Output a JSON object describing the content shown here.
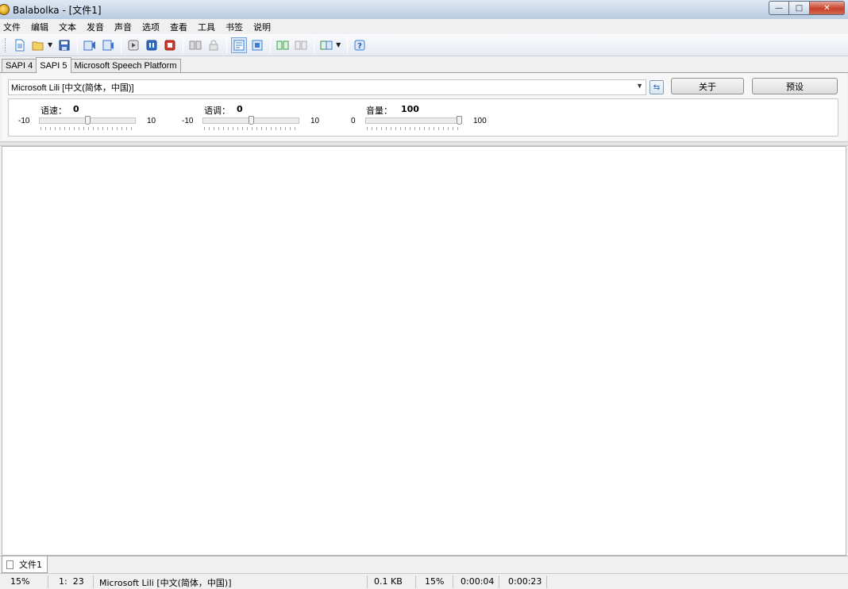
{
  "window": {
    "title": "Balabolka - [文件1]"
  },
  "menu": [
    "文件",
    "编辑",
    "文本",
    "发音",
    "声音",
    "选项",
    "查看",
    "工具",
    "书签",
    "说明"
  ],
  "toolbar": {
    "buttons": [
      {
        "name": "new-document-icon",
        "color": "#3a7fd5"
      },
      {
        "name": "open-folder-icon",
        "color": "#e6b84a"
      },
      {
        "name": "save-icon",
        "color": "#2f5fb0"
      },
      {
        "name": "read-aloud-icon",
        "color": "#3b6fc4"
      },
      {
        "name": "read-clipboard-icon",
        "color": "#3b6fc4"
      },
      {
        "name": "play-icon",
        "color": "#8a8a8a"
      },
      {
        "name": "pause-icon",
        "color": "#2c6cc4"
      },
      {
        "name": "stop-icon",
        "color": "#c62f22"
      },
      {
        "name": "convert-icon",
        "color": "#9a9a9a"
      },
      {
        "name": "lock-icon",
        "color": "#b0b0b0"
      },
      {
        "name": "text-view-icon",
        "color": "#3a7fd5"
      },
      {
        "name": "batch-icon",
        "color": "#3a7fd5"
      },
      {
        "name": "spell-check-icon",
        "color": "#3aa04a"
      },
      {
        "name": "compare-icon",
        "color": "#a8a8a8"
      },
      {
        "name": "dictionary-icon",
        "color": "#3a8a4a"
      },
      {
        "name": "help-icon",
        "color": "#3a7fd5"
      }
    ]
  },
  "sapi_tabs": [
    "SAPI 4",
    "SAPI 5",
    "Microsoft Speech Platform"
  ],
  "active_sapi_tab": "SAPI 5",
  "voice": {
    "selected": "Microsoft Lili [中文(简体，中国)]",
    "about_label": "关于",
    "preset_label": "预设"
  },
  "sliders": {
    "rate": {
      "label": "语速：",
      "value": "0",
      "min": "-10",
      "max": "10",
      "level": 0.5
    },
    "pitch": {
      "label": "语调：",
      "value": "0",
      "min": "-10",
      "max": "10",
      "level": 0.5
    },
    "volume": {
      "label": "音量：",
      "value": "100",
      "min": "0",
      "max": "100",
      "level": 1.0
    }
  },
  "document_tabs": [
    "文件1"
  ],
  "status": {
    "zoom": "15%",
    "position": "1:  23",
    "voice": "Microsoft Lili [中文(简体，中国)]",
    "size": "0.1 KB",
    "percent": "15%",
    "elapsed": "0:00:04",
    "total": "0:00:23"
  },
  "colors": {
    "titlebar": "#cfdcec",
    "editor_bg": "#ffffff",
    "close_button": "#c7412b"
  }
}
